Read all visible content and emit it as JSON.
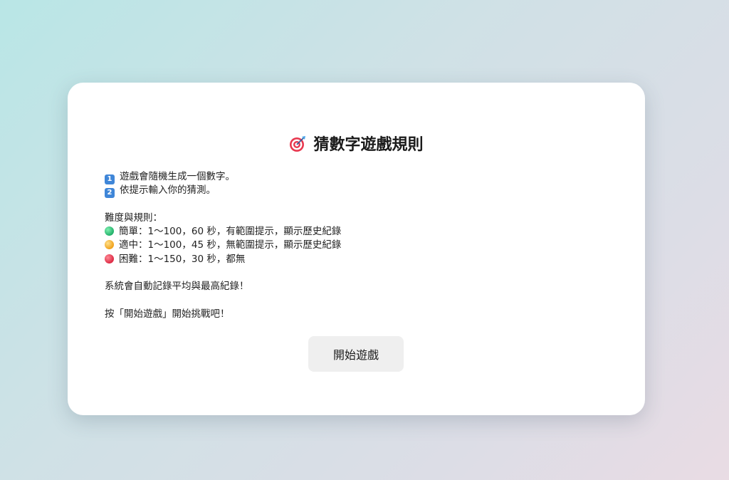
{
  "card": {
    "title": "猜數字遊戲規則",
    "title_icon": "target-dart-icon",
    "steps": [
      {
        "icon": "keycap-1-icon",
        "num": "1",
        "text": "遊戲會隨機生成一個數字。"
      },
      {
        "icon": "keycap-2-icon",
        "num": "2",
        "text": "依提示輸入你的猜測。"
      }
    ],
    "difficulty_heading": "難度與規則：",
    "difficulties": [
      {
        "icon": "green-circle-icon",
        "color": "#22b06a",
        "text": "簡單：1～100，60 秒，有範圍提示，顯示歷史紀錄"
      },
      {
        "icon": "yellow-circle-icon",
        "color": "#f0a21c",
        "text": "適中：1～100，45 秒，無範圍提示，顯示歷史紀錄"
      },
      {
        "icon": "red-circle-icon",
        "color": "#dd2a44",
        "text": "困難：1～150，30 秒，都無"
      }
    ],
    "note": "系統會自動記錄平均與最高紀錄！",
    "prompt": "按「開始遊戲」開始挑戰吧！",
    "start_button_label": "開始遊戲"
  }
}
